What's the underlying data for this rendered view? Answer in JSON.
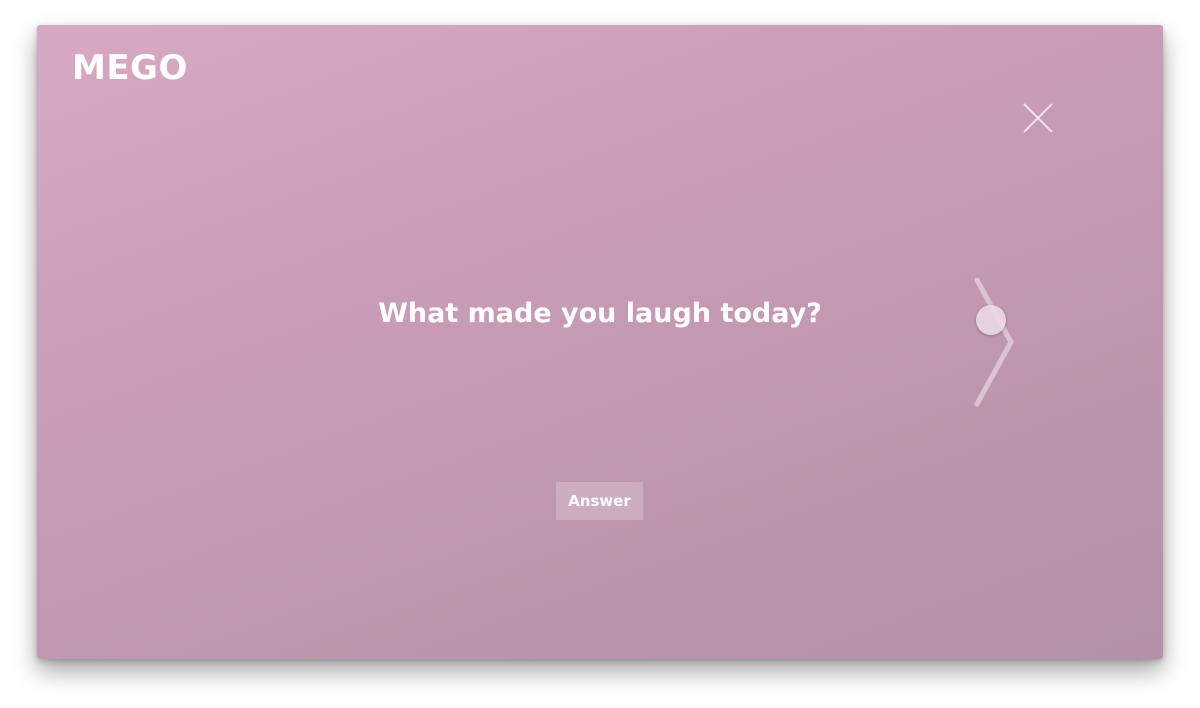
{
  "app": {
    "logo_text": "MEGO"
  },
  "prompt": {
    "question": "What made you laugh today?",
    "answer_label": "Answer"
  },
  "controls": {
    "close_icon": "close-icon",
    "next_icon": "chevron-right-icon"
  },
  "colors": {
    "background_start": "#d7a9c2",
    "background_end": "#b391a8",
    "text": "#ffffff"
  }
}
